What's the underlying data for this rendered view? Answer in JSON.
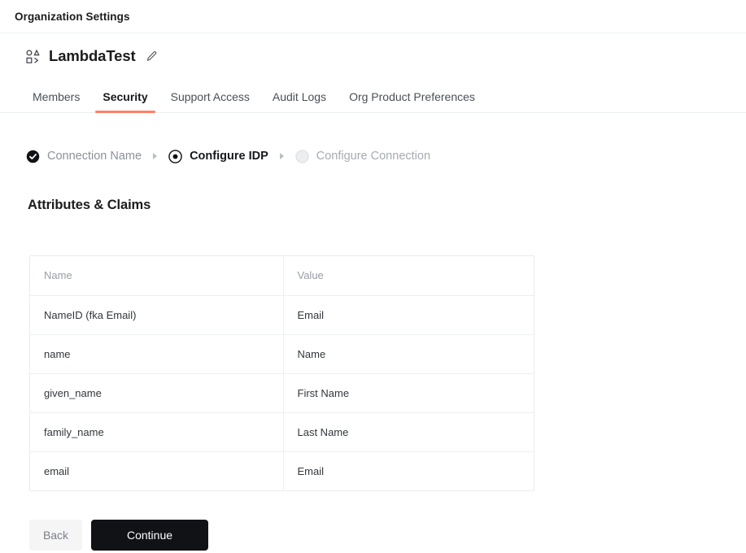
{
  "topbar": {
    "title": "Organization Settings"
  },
  "org": {
    "icon": "shapes-icon",
    "name": "LambdaTest",
    "edit_icon": "pencil-icon"
  },
  "tabs": [
    {
      "label": "Members",
      "active": false
    },
    {
      "label": "Security",
      "active": true
    },
    {
      "label": "Support Access",
      "active": false
    },
    {
      "label": "Audit Logs",
      "active": false
    },
    {
      "label": "Org Product Preferences",
      "active": false
    }
  ],
  "stepper": {
    "separator_icon": "caret-right-icon",
    "steps": [
      {
        "label": "Connection Name",
        "state": "done",
        "icon": "check-circle-filled-icon"
      },
      {
        "label": "Configure IDP",
        "state": "active",
        "icon": "radio-selected-icon"
      },
      {
        "label": "Configure Connection",
        "state": "todo",
        "icon": "circle-empty-icon"
      }
    ]
  },
  "section": {
    "title": "Attributes & Claims"
  },
  "table": {
    "columns": [
      "Name",
      "Value"
    ],
    "rows": [
      {
        "name": "NameID (fka Email)",
        "value": "Email"
      },
      {
        "name": "name",
        "value": "Name"
      },
      {
        "name": "given_name",
        "value": "First Name"
      },
      {
        "name": "family_name",
        "value": "Last Name"
      },
      {
        "name": "email",
        "value": "Email"
      }
    ]
  },
  "actions": {
    "back_label": "Back",
    "continue_label": "Continue"
  },
  "colors": {
    "accent": "#FF8066",
    "primary_button": "#111215",
    "text": "#1c1c1c",
    "muted_text": "#989da5",
    "border": "#ebecee"
  }
}
